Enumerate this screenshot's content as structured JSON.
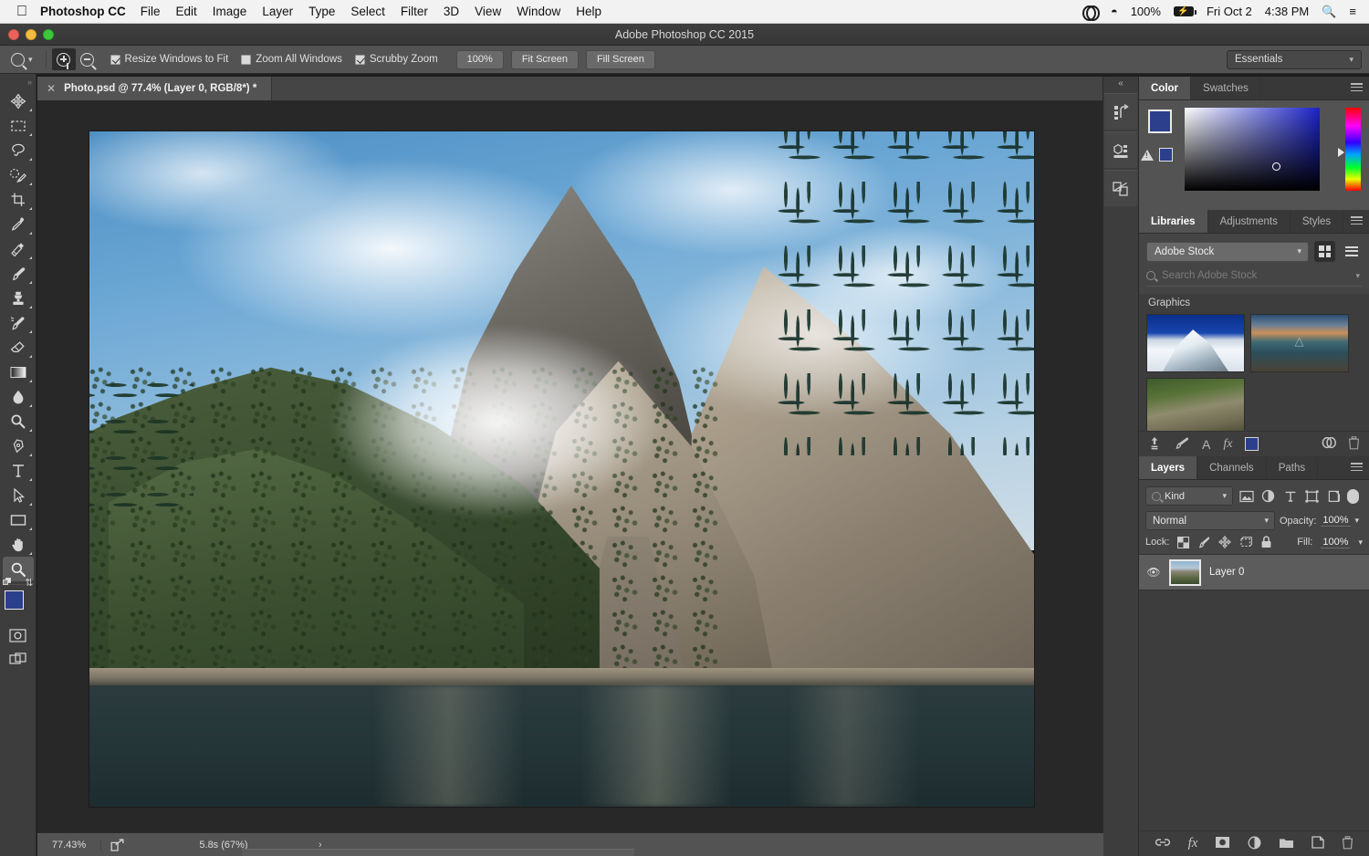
{
  "menubar": {
    "apple_icon": "apple-icon",
    "app_name": "Photoshop CC",
    "items": [
      "File",
      "Edit",
      "Image",
      "Layer",
      "Type",
      "Select",
      "Filter",
      "3D",
      "View",
      "Window",
      "Help"
    ],
    "status": {
      "cc_icon": "creative-cloud-icon",
      "wifi_icon": "wifi-icon",
      "battery_percent": "100%",
      "battery_icon": "battery-charging-icon",
      "date": "Fri Oct 2",
      "time": "4:38 PM",
      "search_icon": "spotlight-search-icon",
      "list_icon": "notification-center-icon"
    }
  },
  "titlebar": {
    "title": "Adobe Photoshop CC 2015"
  },
  "optionsbar": {
    "tool_icon": "zoom-tool-icon",
    "tool_preset_chevron": "chevron-down-icon",
    "zoom_in_icon": "zoom-in-icon",
    "zoom_out_icon": "zoom-out-icon",
    "resize_windows_label": "Resize Windows to Fit",
    "resize_windows_checked": true,
    "zoom_all_label": "Zoom All Windows",
    "zoom_all_checked": false,
    "scrubby_label": "Scrubby Zoom",
    "scrubby_checked": true,
    "btn_100": "100%",
    "btn_fit": "Fit Screen",
    "btn_fill": "Fill Screen",
    "workspace": "Essentials",
    "workspace_chevron": "chevron-down-icon"
  },
  "toolbar": {
    "tools": [
      {
        "name": "move-tool",
        "label": "Move Tool"
      },
      {
        "name": "rectangular-marquee-tool",
        "label": "Rectangular Marquee Tool"
      },
      {
        "name": "lasso-tool",
        "label": "Lasso Tool"
      },
      {
        "name": "quick-selection-tool",
        "label": "Quick Selection Tool"
      },
      {
        "name": "crop-tool",
        "label": "Crop Tool"
      },
      {
        "name": "eyedropper-tool",
        "label": "Eyedropper Tool"
      },
      {
        "name": "spot-healing-brush-tool",
        "label": "Spot Healing Brush Tool"
      },
      {
        "name": "brush-tool",
        "label": "Brush Tool"
      },
      {
        "name": "clone-stamp-tool",
        "label": "Clone Stamp Tool"
      },
      {
        "name": "history-brush-tool",
        "label": "History Brush Tool"
      },
      {
        "name": "eraser-tool",
        "label": "Eraser Tool"
      },
      {
        "name": "gradient-tool",
        "label": "Gradient Tool"
      },
      {
        "name": "blur-tool",
        "label": "Blur Tool"
      },
      {
        "name": "dodge-tool",
        "label": "Dodge Tool"
      },
      {
        "name": "pen-tool",
        "label": "Pen Tool"
      },
      {
        "name": "horizontal-type-tool",
        "label": "Horizontal Type Tool"
      },
      {
        "name": "path-selection-tool",
        "label": "Path Selection Tool"
      },
      {
        "name": "rectangle-tool",
        "label": "Rectangle Tool"
      },
      {
        "name": "hand-tool",
        "label": "Hand Tool"
      },
      {
        "name": "zoom-tool",
        "label": "Zoom Tool",
        "active": true
      }
    ],
    "foreground_color": "#2b3f8c",
    "background_color": "#000000",
    "default_colors_icon": "default-colors-icon",
    "swap_colors_icon": "swap-colors-icon",
    "quick_mask_icon": "quick-mask-mode-icon",
    "screen_mode_icon": "screen-mode-icon"
  },
  "document": {
    "tab_label": "Photo.psd @ 77.4% (Layer 0, RGB/8*) *",
    "close_icon": "close-icon"
  },
  "dockstrip": {
    "collapse_icon": "collapse-panels-icon",
    "icons": [
      {
        "name": "history-panel-icon"
      },
      {
        "name": "properties-panel-icon"
      },
      {
        "name": "adjustments-panel-icon"
      }
    ]
  },
  "color_panel": {
    "tabs": [
      {
        "label": "Color",
        "active": true
      },
      {
        "label": "Swatches",
        "active": false
      }
    ],
    "menu_icon": "panel-menu-icon",
    "foreground": "#2b3f8c",
    "background": "#000000",
    "warning_icon": "out-of-gamut-warning-icon",
    "warning_swatch": "#2b3f8c",
    "picker_icon": "color-field-picker"
  },
  "libraries_panel": {
    "tabs": [
      {
        "label": "Libraries",
        "active": true
      },
      {
        "label": "Adjustments",
        "active": false
      },
      {
        "label": "Styles",
        "active": false
      }
    ],
    "menu_icon": "panel-menu-icon",
    "library_select": "Adobe Stock",
    "library_chevron": "chevron-down-icon",
    "grid_view_icon": "grid-view-icon",
    "list_view_icon": "list-view-icon",
    "search_placeholder": "Search Adobe Stock",
    "search_icon": "search-icon",
    "search_chevron": "chevron-down-icon",
    "section_label": "Graphics",
    "thumbnails": [
      {
        "name": "stock-thumb-snowy-peak"
      },
      {
        "name": "stock-thumb-lake-sunset",
        "watermark": "Adobe Stock"
      },
      {
        "name": "stock-thumb-forest-rock"
      }
    ],
    "footer_icons": [
      {
        "name": "upload-to-library-icon"
      },
      {
        "name": "add-brush-icon"
      },
      {
        "name": "add-text-style-icon"
      },
      {
        "name": "add-layer-style-icon"
      },
      {
        "name": "add-color-icon",
        "color": "#2b3f8c"
      },
      {
        "name": "creative-cloud-sync-icon"
      },
      {
        "name": "delete-icon"
      }
    ]
  },
  "layers_panel": {
    "tabs": [
      {
        "label": "Layers",
        "active": true
      },
      {
        "label": "Channels",
        "active": false
      },
      {
        "label": "Paths",
        "active": false
      }
    ],
    "menu_icon": "panel-menu-icon",
    "filter_kind": "Kind",
    "filter_search_icon": "filter-search-icon",
    "filter_chevron": "chevron-down-icon",
    "filter_icons": [
      {
        "name": "filter-pixel-layers-icon"
      },
      {
        "name": "filter-adjustment-layers-icon"
      },
      {
        "name": "filter-type-layers-icon"
      },
      {
        "name": "filter-shape-layers-icon"
      },
      {
        "name": "filter-smart-object-icon"
      }
    ],
    "filter_toggle_icon": "filter-enable-toggle",
    "blend_mode": "Normal",
    "blend_chevron": "chevron-down-icon",
    "opacity_label": "Opacity:",
    "opacity_value": "100%",
    "opacity_chevron": "chevron-down-icon",
    "lock_label": "Lock:",
    "lock_icons": [
      {
        "name": "lock-transparent-pixels-icon"
      },
      {
        "name": "lock-image-pixels-icon"
      },
      {
        "name": "lock-position-icon"
      },
      {
        "name": "lock-artboard-nesting-icon"
      },
      {
        "name": "lock-all-icon"
      }
    ],
    "fill_label": "Fill:",
    "fill_value": "100%",
    "fill_chevron": "chevron-down-icon",
    "layers": [
      {
        "name": "Layer 0",
        "visible": true,
        "visibility_icon": "eye-icon",
        "thumbnail": "layer-thumbnail-mountain-lake",
        "selected": true
      }
    ],
    "footer_icons": [
      {
        "name": "link-layers-icon"
      },
      {
        "name": "layer-style-fx-icon"
      },
      {
        "name": "add-layer-mask-icon"
      },
      {
        "name": "new-adjustment-layer-icon"
      },
      {
        "name": "new-group-icon"
      },
      {
        "name": "new-layer-icon"
      },
      {
        "name": "delete-layer-icon"
      }
    ]
  },
  "statusbar": {
    "zoom_level": "77.43%",
    "share_icon": "share-icon",
    "doc_info": "5.8s (67%)",
    "expand_chevron": "chevron-right-icon"
  },
  "colors": {
    "panel_bg": "#3d3d3d",
    "panel_mid": "#454545",
    "panel_light": "#535353",
    "canvas_bg": "#282828",
    "accent_blue": "#2b3f8c",
    "text": "#e0e0e0"
  }
}
